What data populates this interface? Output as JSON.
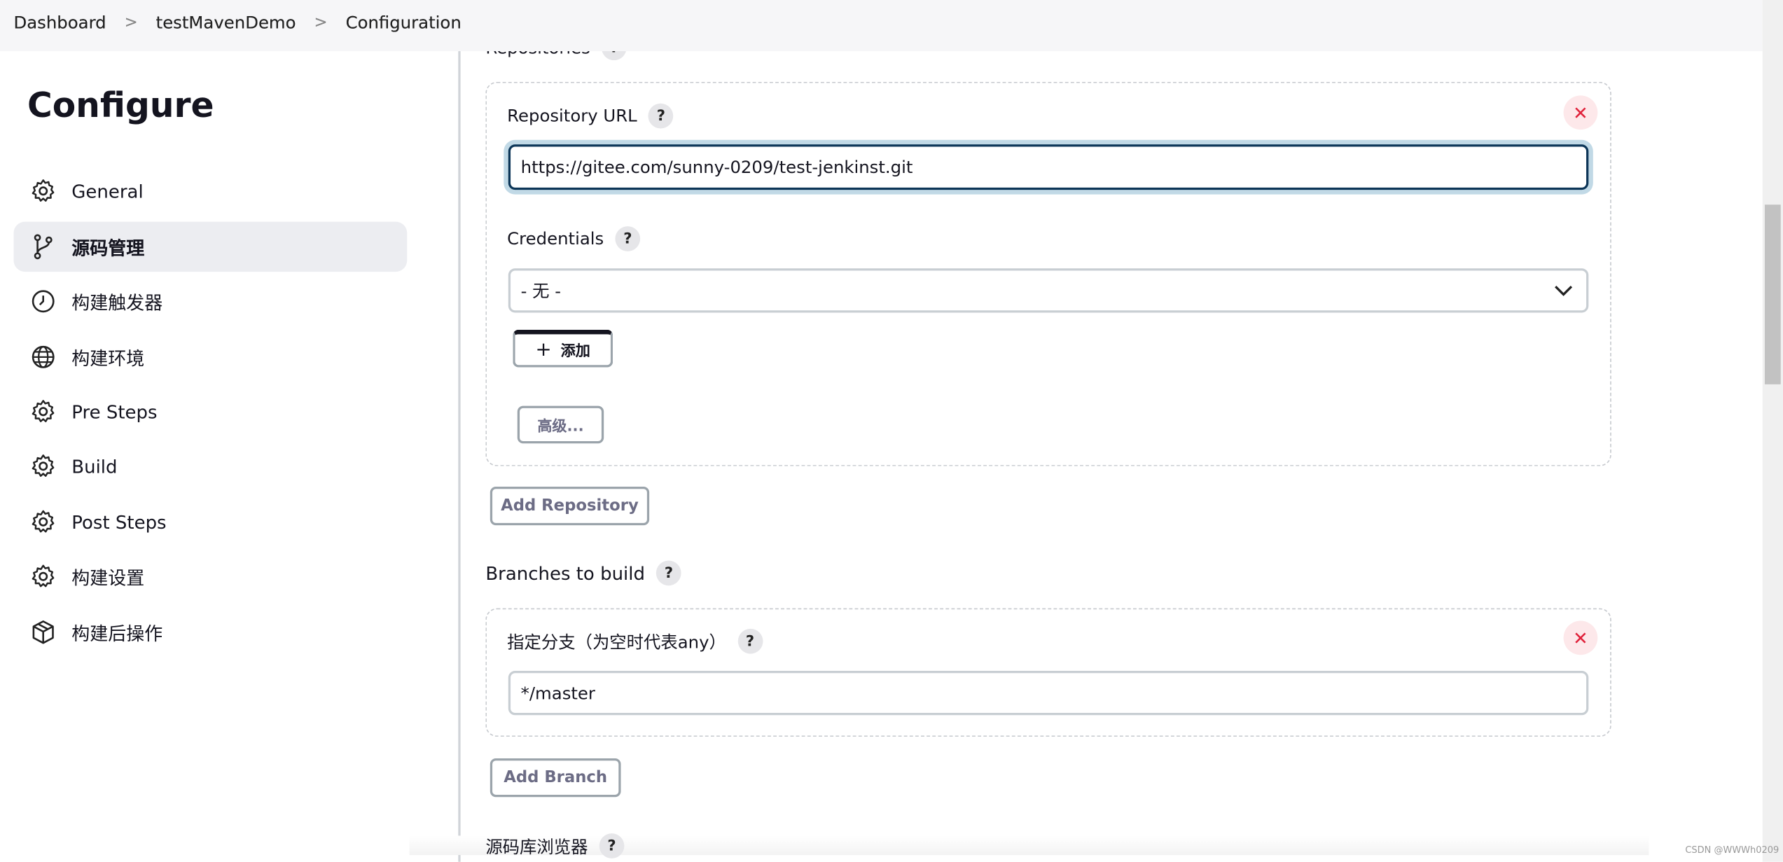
{
  "breadcrumb": [
    "Dashboard",
    "testMavenDemo",
    "Configuration"
  ],
  "sidebar": {
    "title": "Configure",
    "items": [
      {
        "label": "General",
        "icon": "gear-icon"
      },
      {
        "label": "源码管理",
        "icon": "branch-icon",
        "active": true
      },
      {
        "label": "构建触发器",
        "icon": "clock-icon"
      },
      {
        "label": "构建环境",
        "icon": "globe-icon"
      },
      {
        "label": "Pre Steps",
        "icon": "gear-icon"
      },
      {
        "label": "Build",
        "icon": "gear-icon"
      },
      {
        "label": "Post Steps",
        "icon": "gear-icon"
      },
      {
        "label": "构建设置",
        "icon": "gear-icon"
      },
      {
        "label": "构建后操作",
        "icon": "package-icon"
      }
    ]
  },
  "main": {
    "repositories_label": "Repositories",
    "repository_url_label": "Repository URL",
    "repository_url_value": "https://gitee.com/sunny-0209/test-jenkinst.git",
    "credentials_label": "Credentials",
    "credentials_value": "- 无 -",
    "add_label": "添加",
    "advanced_label": "高级...",
    "add_repository_label": "Add Repository",
    "branches_label": "Branches to build",
    "branch_spec_label": "指定分支（为空时代表any）",
    "branch_spec_value": "*/master",
    "add_branch_label": "Add Branch",
    "browser_label": "源码库浏览器",
    "help": "?",
    "close": "✕"
  },
  "watermark": "CSDN @WWWh0209",
  "colors": {
    "accent": "#0c3557",
    "close": "#e0223b"
  }
}
